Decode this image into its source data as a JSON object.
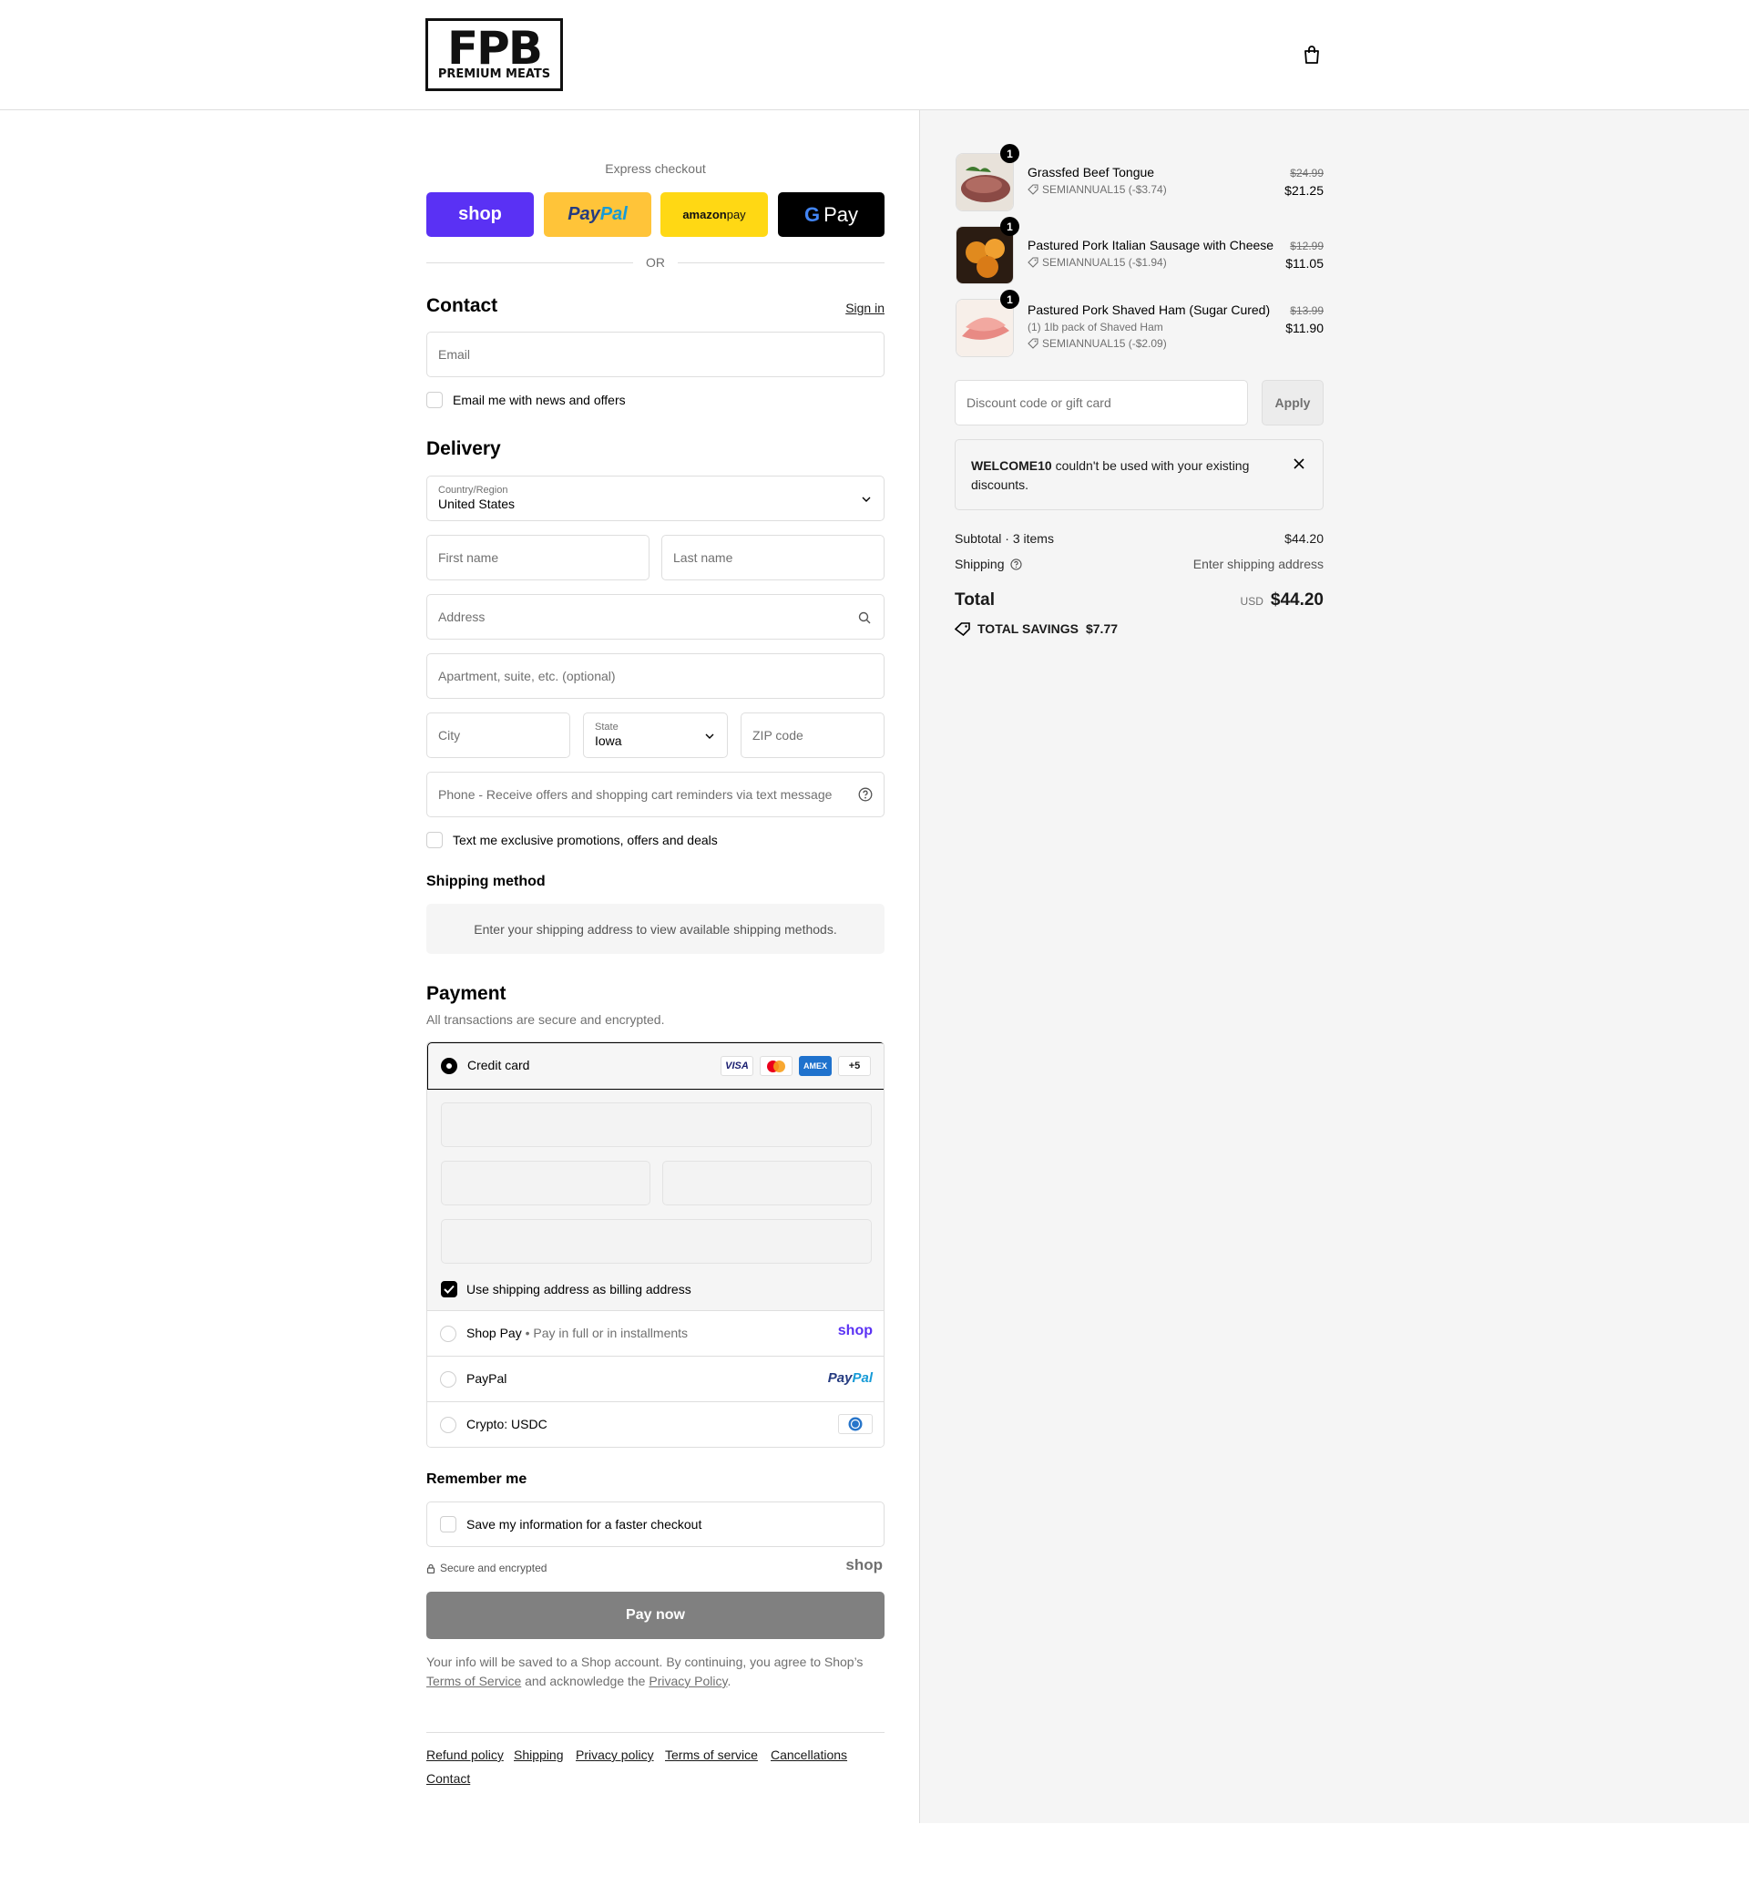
{
  "header": {
    "logo_main": "FPB",
    "logo_sub": "PREMIUM MEATS"
  },
  "express": {
    "title": "Express checkout",
    "shop_label": "shop",
    "paypal_label_a": "Pay",
    "paypal_label_b": "Pal",
    "amazon_label_a": "amazon",
    "amazon_label_b": " pay",
    "gpay_g": "G",
    "gpay_label": "Pay",
    "or_text": "OR"
  },
  "contact": {
    "title": "Contact",
    "sign_in": "Sign in",
    "email_placeholder": "Email",
    "newsletter_label": "Email me with news and offers"
  },
  "delivery": {
    "title": "Delivery",
    "country_label": "Country/Region",
    "country_value": "United States",
    "first_name": "First name",
    "last_name": "Last name",
    "address": "Address",
    "apartment": "Apartment, suite, etc. (optional)",
    "city": "City",
    "state_label": "State",
    "state_value": "Iowa",
    "zip": "ZIP code",
    "phone": "Phone - Receive offers and shopping cart reminders via text message",
    "sms_label": "Text me exclusive promotions, offers and deals"
  },
  "shipping_method": {
    "title": "Shipping method",
    "message": "Enter your shipping address to view available shipping methods."
  },
  "payment": {
    "title": "Payment",
    "subtitle": "All transactions are secure and encrypted.",
    "credit_card_label": "Credit card",
    "card_logos": [
      "VISA",
      "",
      "AMEX",
      "+5"
    ],
    "billing_label": "Use shipping address as billing address",
    "shop_pay_label": "Shop Pay",
    "shop_pay_sub": "Pay in full or in installments",
    "shop_pay_logo": "shop",
    "paypal_label": "PayPal",
    "paypal_logo_a": "Pay",
    "paypal_logo_b": "Pal",
    "crypto_label": "Crypto: USDC"
  },
  "remember": {
    "title": "Remember me",
    "save_label": "Save my information for a faster checkout",
    "secure_text": "Secure and encrypted",
    "shop_logo": "shop"
  },
  "pay_now": "Pay now",
  "legal": {
    "text_a": "Your info will be saved to a Shop account. By continuing, you agree to Shop’s ",
    "terms": "Terms of Service",
    "text_b": " and acknowledge the ",
    "privacy": "Privacy Policy",
    "text_c": "."
  },
  "footer_links": [
    "Refund policy",
    "Shipping",
    "Privacy policy",
    "Terms of service",
    "Cancellations",
    "Contact"
  ],
  "cart": {
    "items": [
      {
        "qty": "1",
        "name": "Grassfed Beef Tongue",
        "variant": "",
        "discount": "SEMIANNUAL15 (-$3.74)",
        "old_price": "$24.99",
        "price": "$21.25"
      },
      {
        "qty": "1",
        "name": "Pastured Pork Italian Sausage with Cheese",
        "variant": "",
        "discount": "SEMIANNUAL15 (-$1.94)",
        "old_price": "$12.99",
        "price": "$11.05"
      },
      {
        "qty": "1",
        "name": "Pastured Pork Shaved Ham (Sugar Cured)",
        "variant": "(1) 1lb pack of Shaved Ham",
        "discount": "SEMIANNUAL15 (-$2.09)",
        "old_price": "$13.99",
        "price": "$11.90"
      }
    ],
    "discount_placeholder": "Discount code or gift card",
    "apply_label": "Apply",
    "error_code": "WELCOME10",
    "error_text": " couldn't be used with your existing discounts.",
    "subtotal_label": "Subtotal · 3 items",
    "subtotal_value": "$44.20",
    "shipping_label": "Shipping",
    "shipping_value": "Enter shipping address",
    "total_label": "Total",
    "currency": "USD",
    "total_value": "$44.20",
    "savings_label": "TOTAL SAVINGS",
    "savings_value": "$7.77"
  },
  "colors": {
    "shop_purple": "#5a31f4",
    "paypal_yellow": "#ffc439",
    "amazon_yellow": "#ffd814",
    "pay_now_gray": "#808080"
  }
}
